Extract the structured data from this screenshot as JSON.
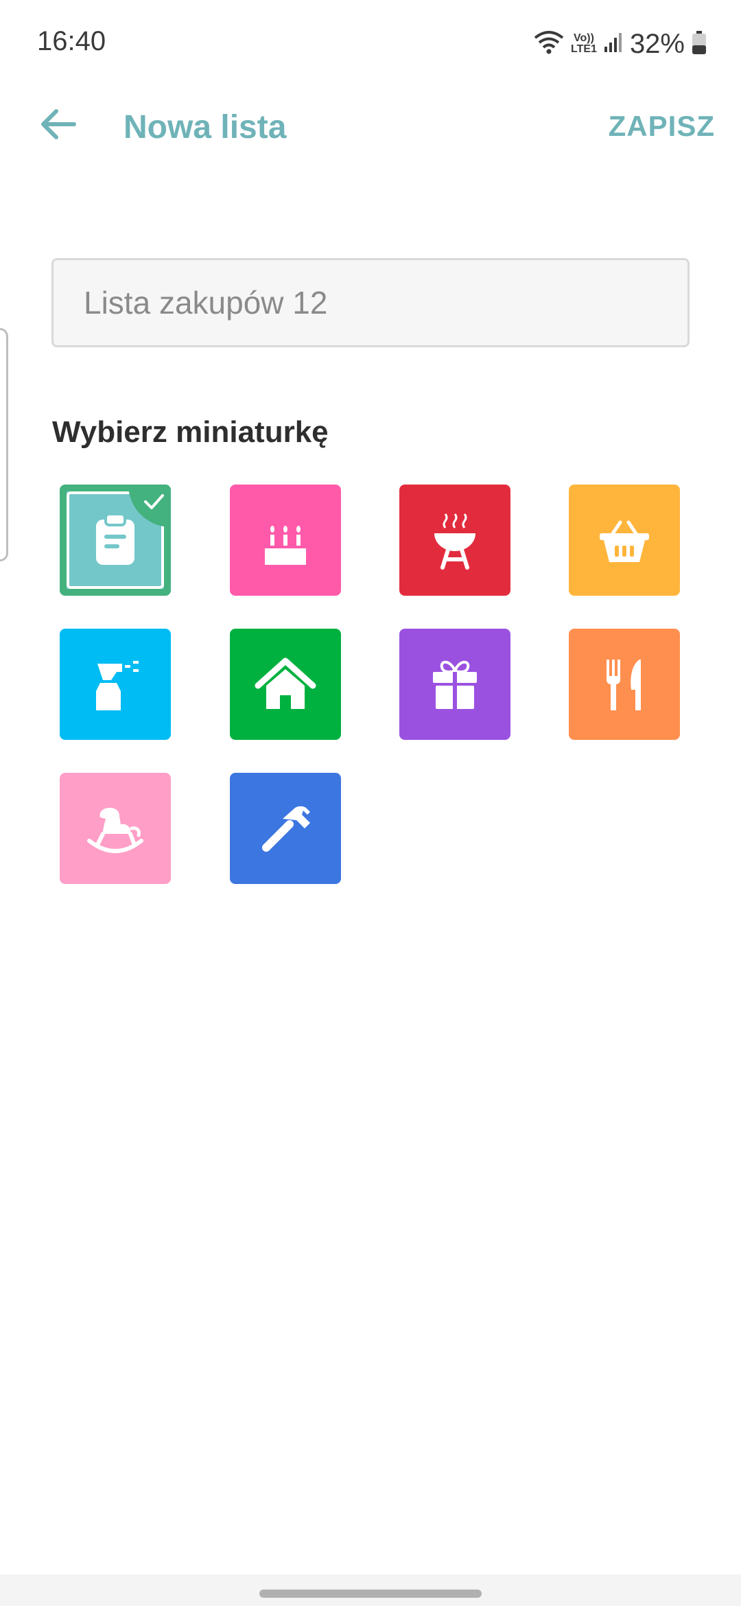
{
  "status": {
    "time": "16:40",
    "lte_top": "Vo))",
    "lte_bottom": "LTE1",
    "battery": "32%"
  },
  "app_bar": {
    "title": "Nowa lista",
    "save_label": "ZAPISZ"
  },
  "form": {
    "name_placeholder": "Lista zakupów 12",
    "name_value": ""
  },
  "thumbnails": {
    "label": "Wybierz miniaturkę",
    "items": [
      {
        "icon": "clipboard-icon",
        "color": "#74c7c9",
        "selected": true
      },
      {
        "icon": "birthday-cake-icon",
        "color": "#ff5aaa",
        "selected": false
      },
      {
        "icon": "grill-icon",
        "color": "#e22c3e",
        "selected": false
      },
      {
        "icon": "shopping-basket-icon",
        "color": "#ffb53c",
        "selected": false
      },
      {
        "icon": "spray-bottle-icon",
        "color": "#00bcf4",
        "selected": false
      },
      {
        "icon": "house-icon",
        "color": "#00b140",
        "selected": false
      },
      {
        "icon": "gift-icon",
        "color": "#9b51e0",
        "selected": false
      },
      {
        "icon": "cutlery-icon",
        "color": "#ff8f4e",
        "selected": false
      },
      {
        "icon": "rocking-horse-icon",
        "color": "#ff9ec7",
        "selected": false
      },
      {
        "icon": "hammer-icon",
        "color": "#3b76e1",
        "selected": false
      }
    ]
  },
  "colors": {
    "accent": "#6fb3b8",
    "selected_border": "#43b27f"
  }
}
